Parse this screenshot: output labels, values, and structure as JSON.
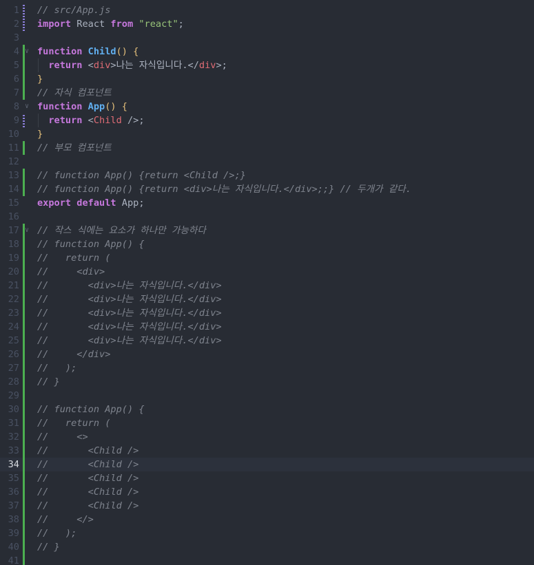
{
  "editor": {
    "current_line": 34,
    "top_partial": "...",
    "lines": [
      {
        "n": 1,
        "bar": "modified",
        "tokens": [
          {
            "t": "comment",
            "v": "// src/App.js"
          }
        ]
      },
      {
        "n": 2,
        "bar": "modified",
        "tokens": [
          {
            "t": "keyword",
            "v": "import"
          },
          {
            "t": "plain",
            "v": " React "
          },
          {
            "t": "keyword",
            "v": "from"
          },
          {
            "t": "plain",
            "v": " "
          },
          {
            "t": "string",
            "v": "\"react\""
          },
          {
            "t": "punct",
            "v": ";"
          }
        ]
      },
      {
        "n": 3,
        "tokens": []
      },
      {
        "n": 4,
        "bar": "added",
        "fold": true,
        "tokens": [
          {
            "t": "keyword",
            "v": "function"
          },
          {
            "t": "plain",
            "v": " "
          },
          {
            "t": "func",
            "v": "Child"
          },
          {
            "t": "paren",
            "v": "()"
          },
          {
            "t": "plain",
            "v": " "
          },
          {
            "t": "paren",
            "v": "{"
          }
        ]
      },
      {
        "n": 5,
        "bar": "added",
        "guide": true,
        "tokens": [
          {
            "t": "plain",
            "v": "  "
          },
          {
            "t": "keyword",
            "v": "return"
          },
          {
            "t": "plain",
            "v": " <"
          },
          {
            "t": "tag",
            "v": "div"
          },
          {
            "t": "plain",
            "v": ">나는 자식입니다.</"
          },
          {
            "t": "tag",
            "v": "div"
          },
          {
            "t": "plain",
            "v": ">;"
          }
        ]
      },
      {
        "n": 6,
        "bar": "added",
        "tokens": [
          {
            "t": "paren",
            "v": "}"
          }
        ]
      },
      {
        "n": 7,
        "bar": "added",
        "tokens": [
          {
            "t": "comment",
            "v": "// 자식 컴포넌트"
          }
        ]
      },
      {
        "n": 8,
        "fold": true,
        "tokens": [
          {
            "t": "keyword",
            "v": "function"
          },
          {
            "t": "plain",
            "v": " "
          },
          {
            "t": "func",
            "v": "App"
          },
          {
            "t": "paren",
            "v": "()"
          },
          {
            "t": "plain",
            "v": " "
          },
          {
            "t": "paren",
            "v": "{"
          }
        ]
      },
      {
        "n": 9,
        "bar": "modified",
        "guide": true,
        "tokens": [
          {
            "t": "plain",
            "v": "  "
          },
          {
            "t": "keyword",
            "v": "return"
          },
          {
            "t": "plain",
            "v": " <"
          },
          {
            "t": "tag",
            "v": "Child"
          },
          {
            "t": "plain",
            "v": " />;"
          }
        ]
      },
      {
        "n": 10,
        "tokens": [
          {
            "t": "paren",
            "v": "}"
          }
        ]
      },
      {
        "n": 11,
        "bar": "added",
        "tokens": [
          {
            "t": "comment",
            "v": "// 부모 컴포넌트"
          }
        ]
      },
      {
        "n": 12,
        "tokens": []
      },
      {
        "n": 13,
        "bar": "added",
        "tokens": [
          {
            "t": "comment",
            "v": "// function App() {return <Child />;}"
          }
        ]
      },
      {
        "n": 14,
        "bar": "added",
        "tokens": [
          {
            "t": "comment",
            "v": "// function App() {return <div>나는 자식입니다.</div>;;} // 두개가 같다."
          }
        ]
      },
      {
        "n": 15,
        "tokens": [
          {
            "t": "keyword",
            "v": "export"
          },
          {
            "t": "plain",
            "v": " "
          },
          {
            "t": "keyword",
            "v": "default"
          },
          {
            "t": "plain",
            "v": " App;"
          }
        ]
      },
      {
        "n": 16,
        "tokens": []
      },
      {
        "n": 17,
        "bar": "added",
        "fold": true,
        "tokens": [
          {
            "t": "comment",
            "v": "// 작스 식에는 요소가 하나만 가능하다"
          }
        ]
      },
      {
        "n": 18,
        "bar": "added",
        "tokens": [
          {
            "t": "comment",
            "v": "// function App() {"
          }
        ]
      },
      {
        "n": 19,
        "bar": "added",
        "tokens": [
          {
            "t": "comment",
            "v": "//   return ("
          }
        ]
      },
      {
        "n": 20,
        "bar": "added",
        "tokens": [
          {
            "t": "comment",
            "v": "//     <div>"
          }
        ]
      },
      {
        "n": 21,
        "bar": "added",
        "tokens": [
          {
            "t": "comment",
            "v": "//       <div>나는 자식입니다.</div>"
          }
        ]
      },
      {
        "n": 22,
        "bar": "added",
        "tokens": [
          {
            "t": "comment",
            "v": "//       <div>나는 자식입니다.</div>"
          }
        ]
      },
      {
        "n": 23,
        "bar": "added",
        "tokens": [
          {
            "t": "comment",
            "v": "//       <div>나는 자식입니다.</div>"
          }
        ]
      },
      {
        "n": 24,
        "bar": "added",
        "tokens": [
          {
            "t": "comment",
            "v": "//       <div>나는 자식입니다.</div>"
          }
        ]
      },
      {
        "n": 25,
        "bar": "added",
        "tokens": [
          {
            "t": "comment",
            "v": "//       <div>나는 자식입니다.</div>"
          }
        ]
      },
      {
        "n": 26,
        "bar": "added",
        "tokens": [
          {
            "t": "comment",
            "v": "//     </div>"
          }
        ]
      },
      {
        "n": 27,
        "bar": "added",
        "tokens": [
          {
            "t": "comment",
            "v": "//   );"
          }
        ]
      },
      {
        "n": 28,
        "bar": "added",
        "tokens": [
          {
            "t": "comment",
            "v": "// }"
          }
        ]
      },
      {
        "n": 29,
        "bar": "added",
        "tokens": []
      },
      {
        "n": 30,
        "bar": "added",
        "tokens": [
          {
            "t": "comment",
            "v": "// function App() {"
          }
        ]
      },
      {
        "n": 31,
        "bar": "added",
        "tokens": [
          {
            "t": "comment",
            "v": "//   return ("
          }
        ]
      },
      {
        "n": 32,
        "bar": "added",
        "tokens": [
          {
            "t": "comment",
            "v": "//     <>"
          }
        ]
      },
      {
        "n": 33,
        "bar": "added",
        "tokens": [
          {
            "t": "comment",
            "v": "//       <Child />"
          }
        ]
      },
      {
        "n": 34,
        "bar": "added",
        "tokens": [
          {
            "t": "comment",
            "v": "//       <Child />"
          }
        ]
      },
      {
        "n": 35,
        "bar": "added",
        "tokens": [
          {
            "t": "comment",
            "v": "//       <Child />"
          }
        ]
      },
      {
        "n": 36,
        "bar": "added",
        "tokens": [
          {
            "t": "comment",
            "v": "//       <Child />"
          }
        ]
      },
      {
        "n": 37,
        "bar": "added",
        "tokens": [
          {
            "t": "comment",
            "v": "//       <Child />"
          }
        ]
      },
      {
        "n": 38,
        "bar": "added",
        "tokens": [
          {
            "t": "comment",
            "v": "//     </>"
          }
        ]
      },
      {
        "n": 39,
        "bar": "added",
        "tokens": [
          {
            "t": "comment",
            "v": "//   );"
          }
        ]
      },
      {
        "n": 40,
        "bar": "added",
        "tokens": [
          {
            "t": "comment",
            "v": "// }"
          }
        ]
      },
      {
        "n": 41,
        "bar": "added",
        "tokens": []
      }
    ]
  }
}
